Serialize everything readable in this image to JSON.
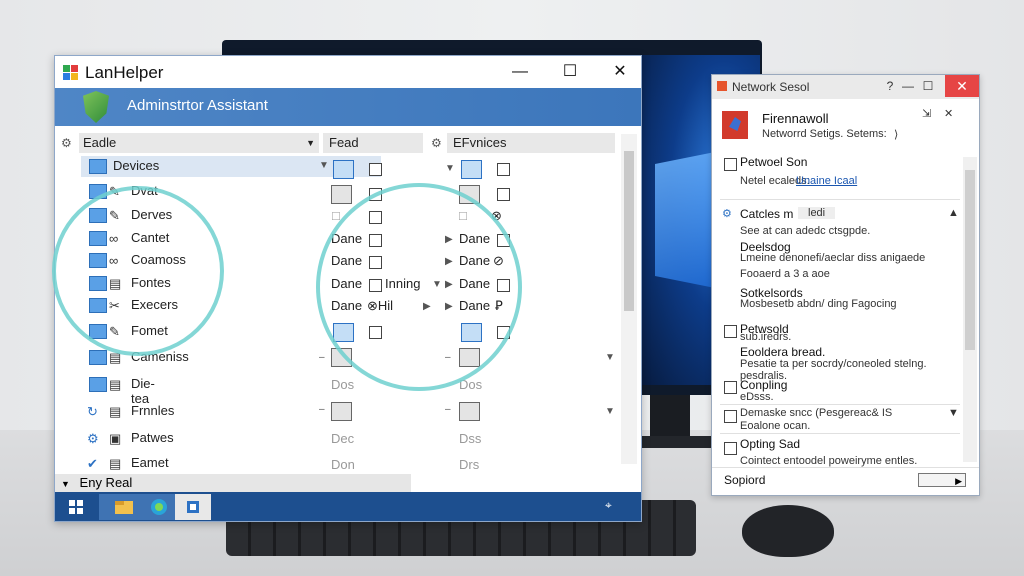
{
  "main_window": {
    "title": "LanHelper",
    "banner": "Adminstrtor Assistant",
    "controls": {
      "minimize": "—",
      "maximize": "☐",
      "close": "✕"
    },
    "columns": {
      "col1": "Eadle",
      "col2": "Fead",
      "col3": "EFvnices"
    },
    "tree_rows": [
      {
        "label": "Devices"
      },
      {
        "label": "Dvat"
      },
      {
        "label": "Derves"
      },
      {
        "label": "Cantet"
      },
      {
        "label": "Coamoss"
      },
      {
        "label": "Fontes"
      },
      {
        "label": "Execers"
      },
      {
        "label": "Fomet"
      },
      {
        "label": "Cameniss"
      },
      {
        "label": "Die-tea"
      },
      {
        "label": "Frnnles"
      },
      {
        "label": "Patwes"
      },
      {
        "label": "Eamet"
      }
    ],
    "mid_cells": [
      "Dane",
      "Dane",
      "Dane",
      "Dane"
    ],
    "mid_extra": [
      "Inning",
      "⊗Hil"
    ],
    "right_cells": [
      "Dane",
      "Dane",
      "Dane",
      "Dane"
    ],
    "faint_cells": [
      "Dos",
      "Dec",
      "Don"
    ],
    "right_faint": [
      "Dos",
      "Dss",
      "Drs"
    ],
    "status_text": "Eny Real"
  },
  "side_window": {
    "title": "Network Sesol",
    "heading": "Firennawoll",
    "subheading": "Networrd Setigs. Setems:",
    "sections": [
      {
        "title": "Petwoel Son",
        "line": "Netel ecaleds:",
        "link": "Unaine Icaal"
      },
      {
        "title": "Catcles m",
        "tag": "ledi",
        "lines": [
          "See at can adedc ctsgpde.",
          "Deelsdog",
          "Lmeine denonefi/aeclar diss anigaede",
          "Fooaerd a 3 a aoe",
          "Sotkelsords",
          "Mosbesetb abdn/ ding Fagocing"
        ]
      },
      {
        "title": "Petwsold",
        "lines": [
          "sub.iredrs.",
          "Eooldera bread.",
          "Pesatie ta per socrdy/coneoled stelng.",
          "pesdralis."
        ]
      },
      {
        "title": "Conpling",
        "lines": [
          "eDsss."
        ]
      },
      {
        "title": "Demaske sncc (Pesgereac& IS",
        "lines": [
          "Eoalone ocan."
        ]
      },
      {
        "title": "Opting Sad",
        "lines": [
          "Cointect entoodel poweiryme entles."
        ]
      }
    ],
    "footer_label": "Sopiord",
    "controls": {
      "help": "?",
      "minimize": "—",
      "maximize": "☐",
      "close": "✕"
    }
  },
  "colors": {
    "accent": "#3c76bb",
    "highlight_circle": "#6fd0cf",
    "close_red": "#e64545"
  },
  "icons": [
    "lanhelper-logo-icon",
    "shield-icon",
    "folder-icon",
    "gear-icon",
    "windows-start-icon",
    "firewall-icon"
  ]
}
